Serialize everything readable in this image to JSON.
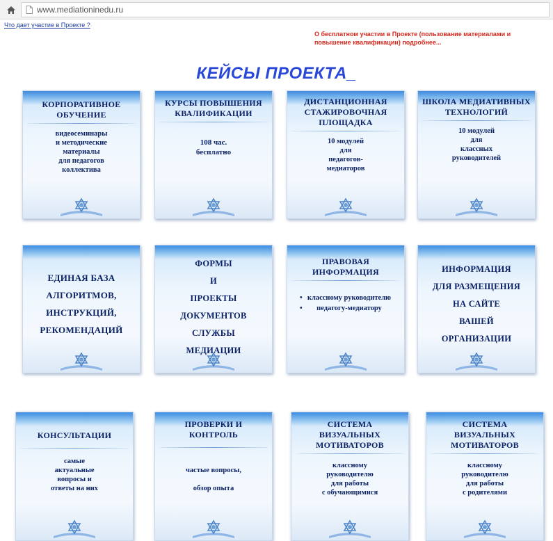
{
  "browser": {
    "url": "www.mediationinedu.ru"
  },
  "links": {
    "participation_link": "Что дает участие в Проекте ?"
  },
  "notice": "О бесплатном участии в Проекте (пользование материалами и повышение квалификации) подробнее...",
  "title": "КЕЙСЫ ПРОЕКТА_",
  "colors": {
    "title": "#2a48d8",
    "notice": "#d9261c",
    "card_text": "#0b2266",
    "card_band": "#3d8be0"
  },
  "cards": [
    {
      "title": "КОРПОРАТИВНОЕ ОБУЧЕНИЕ",
      "lines": [
        "видеосеминары",
        "и методические",
        "материалы",
        "для педагогов",
        "коллектива"
      ]
    },
    {
      "title": "КУРСЫ ПОВЫШЕНИЯ КВАЛИФИКАЦИИ",
      "lines": [
        "108 час.",
        "бесплатно"
      ]
    },
    {
      "title": "ДИСТАНЦИОННАЯ СТАЖИРОВОЧНАЯ ПЛОЩАДКА",
      "lines": [
        "10 модулей",
        "для",
        "педагогов-",
        "медиаторов"
      ]
    },
    {
      "title": "ШКОЛА МЕДИАТИВНЫХ ТЕХНОЛОГИЙ",
      "lines": [
        "10 модулей",
        "для",
        "классных",
        "руководителей"
      ]
    },
    {
      "lines": [
        "ЕДИНАЯ БАЗА",
        "АЛГОРИТМОВ,",
        "ИНСТРУКЦИЙ,",
        "РЕКОМЕНДАЦИЙ"
      ]
    },
    {
      "lines": [
        "ФОРМЫ",
        "И",
        "ПРОЕКТЫ",
        "ДОКУМЕНТОВ",
        "СЛУЖБЫ",
        "МЕДИАЦИИ"
      ]
    },
    {
      "title": "ПРАВОВАЯ ИНФОРМАЦИЯ",
      "bullets": [
        "классному руководителю",
        "педагогу-медиатору"
      ]
    },
    {
      "lines": [
        "ИНФОРМАЦИЯ",
        "ДЛЯ РАЗМЕЩЕНИЯ",
        "НА САЙТЕ",
        "ВАШЕЙ",
        "ОРГАНИЗАЦИИ"
      ]
    },
    {
      "title": "КОНСУЛЬТАЦИИ",
      "lines": [
        "самые",
        "актуальные",
        "вопросы и",
        "ответы на них"
      ]
    },
    {
      "title": "ПРОВЕРКИ И КОНТРОЛЬ",
      "lines": [
        "частые вопросы,",
        "",
        "обзор опыта"
      ]
    },
    {
      "title": "СИСТЕМА ВИЗУАЛЬНЫХ МОТИВАТОРОВ",
      "lines": [
        "классному",
        "руководителю",
        "для работы",
        "с обучающимися"
      ]
    },
    {
      "title": "СИСТЕМА ВИЗУАЛЬНЫХ МОТИВАТОРОВ",
      "lines": [
        "классному",
        "руководителю",
        "для работы",
        "с родителями"
      ]
    }
  ]
}
